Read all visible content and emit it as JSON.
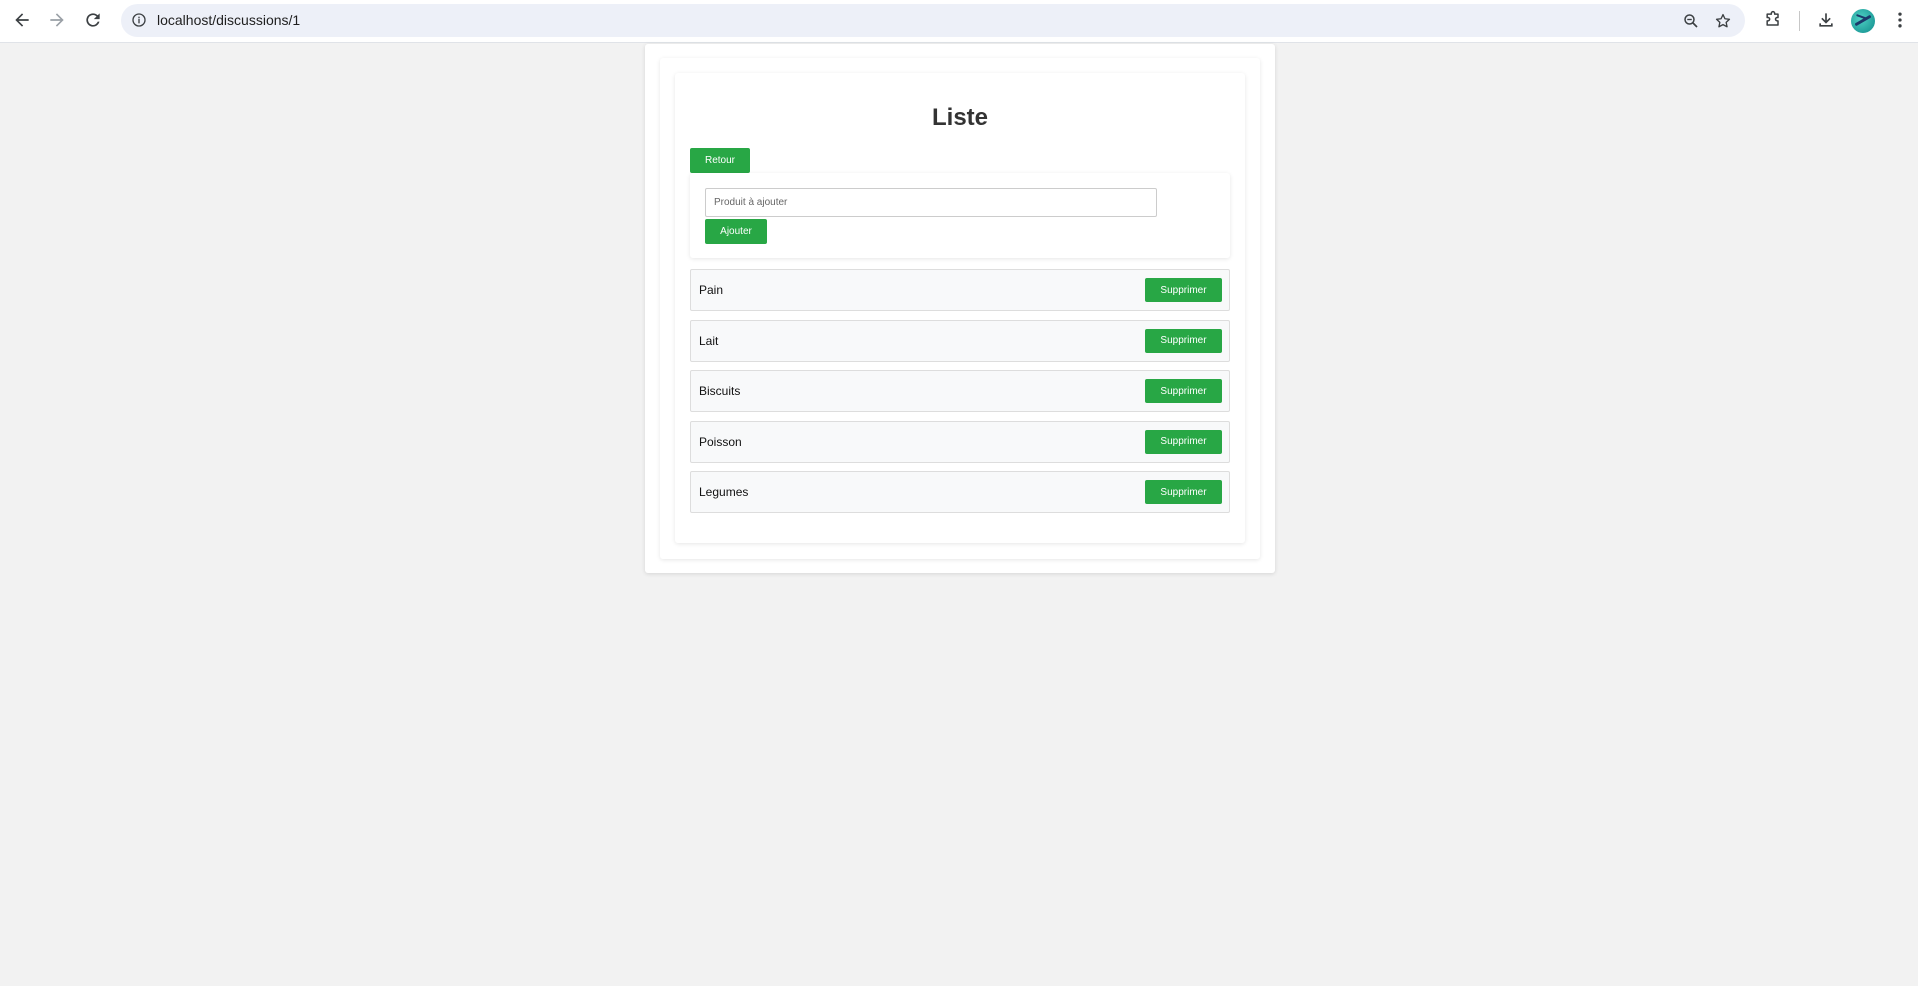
{
  "browser": {
    "url": "localhost/discussions/1",
    "icons": {
      "back": "arrow-left-icon",
      "forward": "arrow-right-icon",
      "reload": "reload-icon",
      "site_info": "info-icon",
      "zoom": "zoom-icon",
      "bookmark": "star-icon",
      "extensions": "puzzle-icon",
      "downloads": "download-icon",
      "profile": "avatar",
      "menu": "kebab-menu-icon"
    }
  },
  "page": {
    "title": "Liste",
    "back_label": "Retour",
    "add_form": {
      "placeholder": "Produit à ajouter",
      "value": "",
      "add_label": "Ajouter"
    },
    "items": [
      {
        "label": "Pain",
        "delete_label": "Supprimer"
      },
      {
        "label": "Lait",
        "delete_label": "Supprimer"
      },
      {
        "label": "Biscuits",
        "delete_label": "Supprimer"
      },
      {
        "label": "Poisson",
        "delete_label": "Supprimer"
      },
      {
        "label": "Legumes",
        "delete_label": "Supprimer"
      }
    ]
  },
  "colors": {
    "accent_green": "#28a745",
    "page_background": "#f2f2f2",
    "item_background": "#f8f9fa"
  }
}
